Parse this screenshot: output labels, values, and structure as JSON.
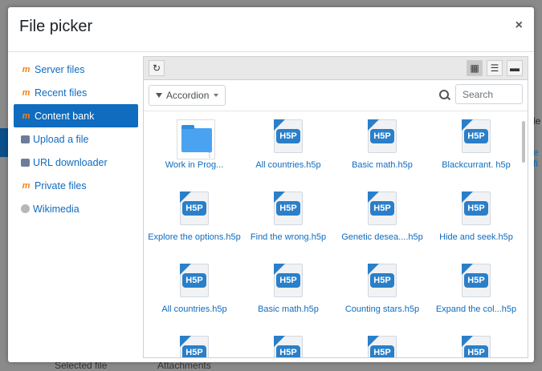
{
  "background": {
    "right_top": "le",
    "right_link": "e fi",
    "bottom_left": "Selected file",
    "bottom_mid": "Attachments"
  },
  "dialog": {
    "title": "File picker",
    "close_glyph": "×"
  },
  "sidebar": {
    "items": [
      {
        "label": "Server files",
        "icon": "moodle-icon"
      },
      {
        "label": "Recent files",
        "icon": "moodle-icon"
      },
      {
        "label": "Content bank",
        "icon": "moodle-icon",
        "active": true
      },
      {
        "label": "Upload a file",
        "icon": "upload-icon"
      },
      {
        "label": "URL downloader",
        "icon": "upload-icon"
      },
      {
        "label": "Private files",
        "icon": "moodle-icon"
      },
      {
        "label": "Wikimedia",
        "icon": "globe-icon"
      }
    ]
  },
  "toolbar": {
    "refresh_glyph": "↻",
    "view_icons_glyph": "▦",
    "view_list_glyph": "☰",
    "view_tree_glyph": "▬"
  },
  "filter": {
    "label": "Accordion",
    "search_placeholder": "Search"
  },
  "files": [
    {
      "name": "Work in Prog...",
      "type": "folder"
    },
    {
      "name": "All countries.h5p",
      "type": "h5p"
    },
    {
      "name": "Basic math.h5p",
      "type": "h5p"
    },
    {
      "name": "Blackcurrant. h5p",
      "type": "h5p"
    },
    {
      "name": "Explore the options.h5p",
      "type": "h5p"
    },
    {
      "name": "Find the wrong.h5p",
      "type": "h5p"
    },
    {
      "name": "Genetic desea....h5p",
      "type": "h5p"
    },
    {
      "name": "Hide and seek.h5p",
      "type": "h5p"
    },
    {
      "name": "All countries.h5p",
      "type": "h5p"
    },
    {
      "name": "Basic math.h5p",
      "type": "h5p"
    },
    {
      "name": "Counting stars.h5p",
      "type": "h5p"
    },
    {
      "name": "Expand the col...h5p",
      "type": "h5p"
    },
    {
      "name": "",
      "type": "h5p"
    },
    {
      "name": "",
      "type": "h5p"
    },
    {
      "name": "",
      "type": "h5p"
    },
    {
      "name": "",
      "type": "h5p"
    }
  ],
  "badge_text": "H5P",
  "colors": {
    "accent": "#0f6cbf",
    "h5p_blue": "#2a7fc8",
    "moodle_orange": "#f98012"
  }
}
